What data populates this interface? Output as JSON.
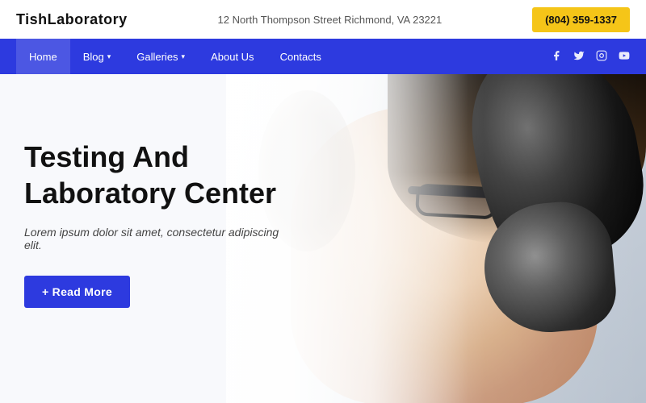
{
  "topbar": {
    "logo": "TishLaboratory",
    "address": "12 North Thompson Street Richmond, VA 23221",
    "phone": "(804) 359-1337"
  },
  "nav": {
    "items": [
      {
        "label": "Home",
        "active": true,
        "hasDropdown": false
      },
      {
        "label": "Blog",
        "active": false,
        "hasDropdown": true
      },
      {
        "label": "Galleries",
        "active": false,
        "hasDropdown": true
      },
      {
        "label": "About Us",
        "active": false,
        "hasDropdown": false
      },
      {
        "label": "Contacts",
        "active": false,
        "hasDropdown": false
      }
    ],
    "social": [
      {
        "name": "facebook",
        "icon": "f"
      },
      {
        "name": "twitter",
        "icon": "t"
      },
      {
        "name": "instagram",
        "icon": "i"
      },
      {
        "name": "youtube",
        "icon": "y"
      }
    ]
  },
  "hero": {
    "title": "Testing And Laboratory Center",
    "subtitle": "Lorem ipsum dolor sit amet, consectetur adipiscing elit.",
    "cta_label": "+ Read More"
  }
}
